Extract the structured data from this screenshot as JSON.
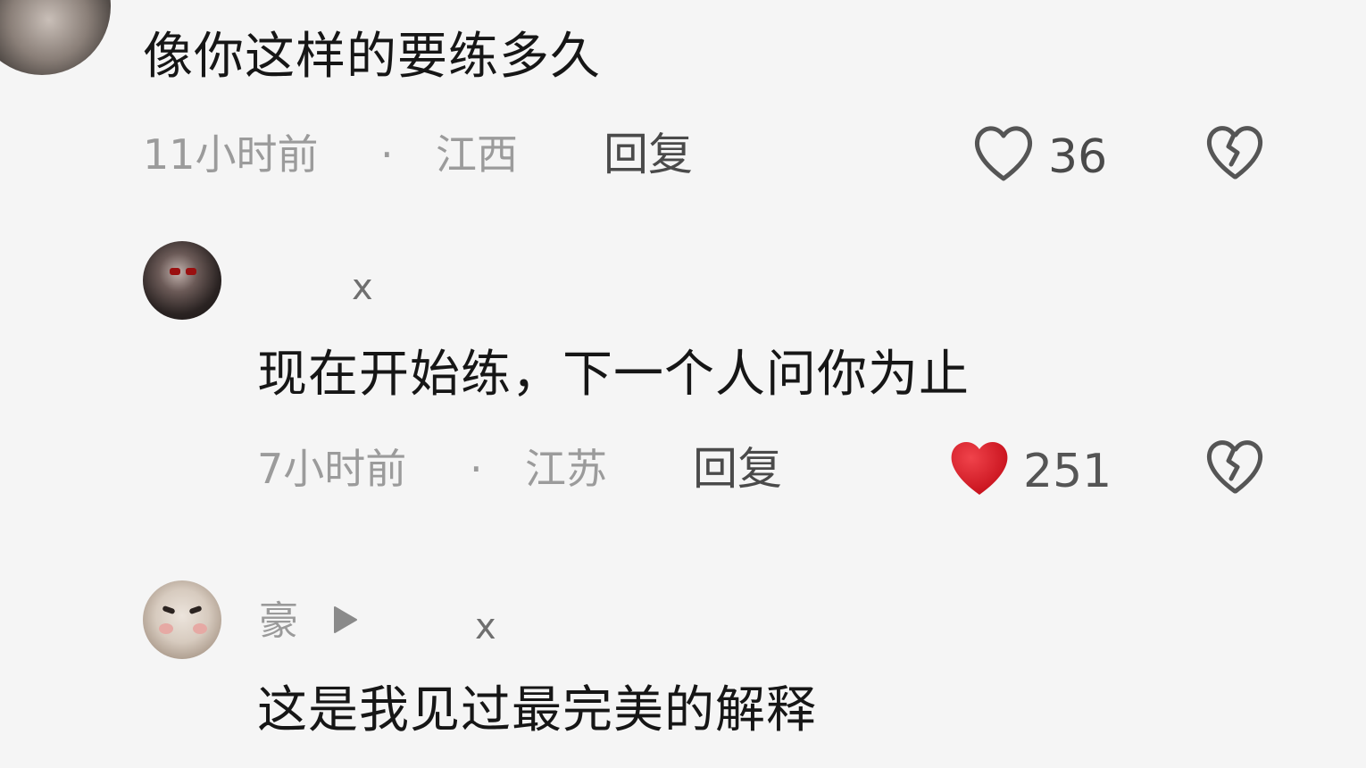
{
  "comments": [
    {
      "text": "像你这样的要练多久",
      "time": "11小时前",
      "dot": "·",
      "location": "江西",
      "reply_label": "回复",
      "like_count": "36",
      "liked": false
    },
    {
      "author": "",
      "author_suffix": "x",
      "text": "现在开始练，下一个人问你为止",
      "time": "7小时前",
      "dot": "·",
      "location": "江苏",
      "reply_label": "回复",
      "like_count": "251",
      "liked": true
    },
    {
      "author": "豪",
      "author_suffix": "x",
      "text": "这是我见过最完美的解释"
    }
  ],
  "colors": {
    "background": "#f5f5f5",
    "liked_heart": "#d4202a",
    "meta_text": "#9b9b9b"
  },
  "icons": {
    "like": "heart-outline-icon",
    "liked": "heart-filled-icon",
    "dislike": "broken-heart-icon",
    "reply_to": "play-triangle-icon"
  }
}
